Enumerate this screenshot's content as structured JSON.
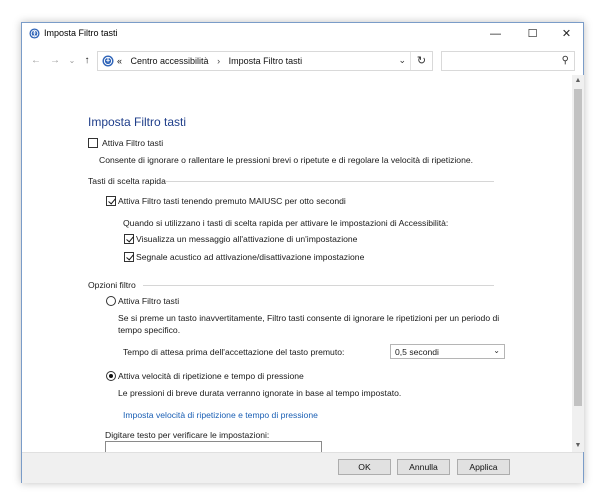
{
  "window": {
    "title": "Imposta Filtro tasti",
    "controls": {
      "minimize": "—",
      "maximize": "☐",
      "close": "✕"
    }
  },
  "nav": {
    "back_icon": "←",
    "forward_icon": "→",
    "history_icon": "⌄",
    "up_icon": "↑",
    "breadcrumb_prefix": "«",
    "breadcrumb": [
      "Centro accessibilità",
      "Imposta Filtro tasti"
    ],
    "breadcrumb_sep": "›",
    "dropdown_icon": "⌄",
    "refresh_icon": "↻",
    "search_icon": "⚲",
    "search_placeholder": ""
  },
  "content": {
    "heading": "Imposta Filtro tasti",
    "enable_filter": {
      "label": "Attiva Filtro tasti",
      "checked": false
    },
    "enable_description": "Consente di ignorare o rallentare le pressioni brevi o ripetute e di regolare la velocità di ripetizione.",
    "shortcuts": {
      "title": "Tasti di scelta rapida",
      "shift_option": {
        "label": "Attiva Filtro tasti tenendo premuto MAIUSC per otto secondi",
        "checked": true
      },
      "intro": "Quando si utilizzano i tasti di scelta rapida per attivare le impostazioni di Accessibilità:",
      "show_message": {
        "label": "Visualizza un messaggio all'attivazione di un'impostazione",
        "checked": true
      },
      "sound": {
        "label": "Segnale acustico ad attivazione/disattivazione impostazione",
        "checked": true
      }
    },
    "filter_options": {
      "title": "Opzioni filtro",
      "bounce_option": {
        "label": "Attiva Filtro tasti",
        "selected": false
      },
      "bounce_description_1": "Se si preme un tasto inavvertitamente, Filtro tasti consente di ignorare le ripetizioni per un periodo di",
      "bounce_description_2": "tempo specifico.",
      "wait_label": "Tempo di attesa prima dell'accettazione del tasto premuto:",
      "wait_value": "0,5 secondi",
      "repeat_option": {
        "label": "Attiva velocità di ripetizione e tempo di pressione",
        "selected": true
      },
      "repeat_description": "Le pressioni di breve durata verranno ignorate in base al tempo impostato.",
      "repeat_link": "Imposta velocità di ripetizione e tempo di pressione",
      "test_label": "Digitare testo per verificare le impostazioni:",
      "test_value": ""
    }
  },
  "footer": {
    "ok": "OK",
    "cancel": "Annulla",
    "apply": "Applica"
  },
  "colors": {
    "heading": "#1f3e8a",
    "link": "#1a5fb4",
    "footer_bg": "#f0f0f0",
    "button_bg": "#e1e1e1"
  }
}
